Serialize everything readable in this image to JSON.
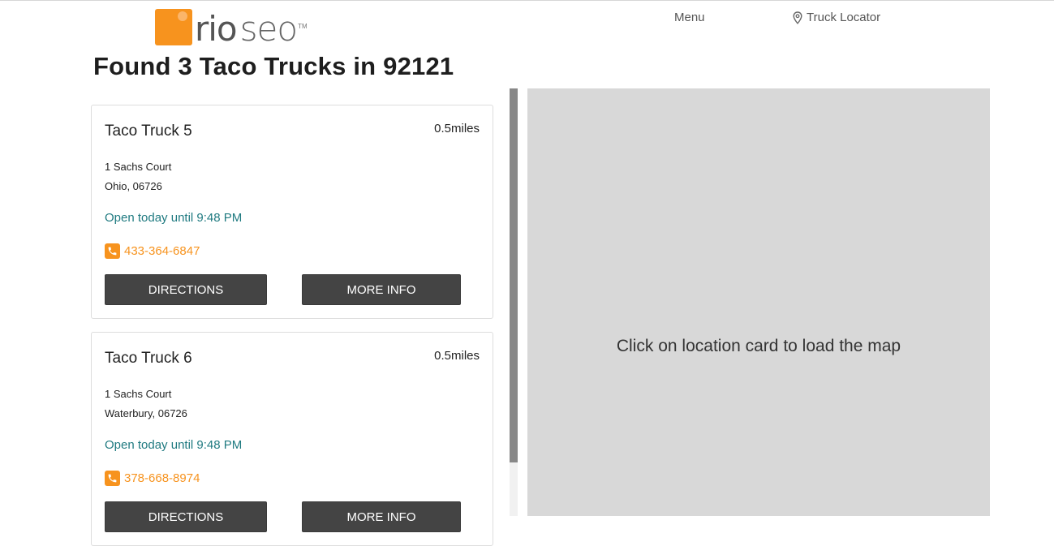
{
  "header": {
    "logo_primary": "rio",
    "logo_secondary": "seo",
    "logo_tm": "TM",
    "nav": {
      "menu_label": "Menu",
      "truck_locator_label": "Truck Locator"
    }
  },
  "page_title": "Found 3 Taco Trucks in 92121",
  "results": [
    {
      "name": "Taco Truck 5",
      "distance": "0.5miles",
      "address_line1": "1 Sachs Court",
      "address_line2": "Ohio, 06726",
      "hours": "Open today until 9:48 PM",
      "phone": "433-364-6847",
      "directions_label": "DIRECTIONS",
      "more_info_label": "MORE INFO"
    },
    {
      "name": "Taco Truck 6",
      "distance": "0.5miles",
      "address_line1": "1 Sachs Court",
      "address_line2": "Waterbury, 06726",
      "hours": "Open today until 9:48 PM",
      "phone": "378-668-8974",
      "directions_label": "DIRECTIONS",
      "more_info_label": "MORE INFO"
    }
  ],
  "map": {
    "message": "Click on location card to load the map"
  },
  "colors": {
    "brand_orange": "#f7931e",
    "hours_teal": "#1f7a80",
    "button_dark": "#444444",
    "map_gray": "#d8d8d8"
  },
  "icons": {
    "truck_locator": "map-pin-icon",
    "phone": "phone-icon"
  }
}
